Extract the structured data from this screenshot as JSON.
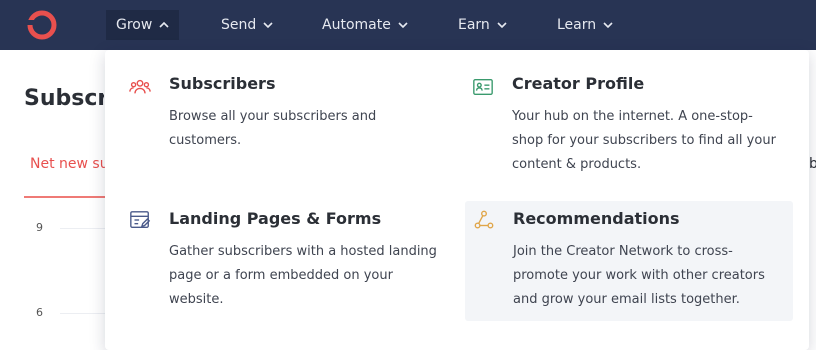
{
  "nav": {
    "items": [
      {
        "label": "Grow"
      },
      {
        "label": "Send"
      },
      {
        "label": "Automate"
      },
      {
        "label": "Earn"
      },
      {
        "label": "Learn"
      }
    ]
  },
  "background": {
    "page_title": "Subscribers",
    "active_tab": "Net new subscribers",
    "right_peek": "b",
    "axis_ticks": [
      "9",
      "6"
    ]
  },
  "dropdown": {
    "items": [
      {
        "title": "Subscribers",
        "description": "Browse all your subscribers and customers.",
        "icon": "users-icon"
      },
      {
        "title": "Creator Profile",
        "description": "Your hub on the internet. A one-stop-shop for your subscribers to find all your content & products.",
        "icon": "profile-card-icon"
      },
      {
        "title": "Landing Pages & Forms",
        "description": "Gather subscribers with a hosted landing page or a form embedded on your website.",
        "icon": "form-edit-icon"
      },
      {
        "title": "Recommendations",
        "description": "Join the Creator Network to cross-promote your work with other creators and grow your email lists together.",
        "icon": "network-icon"
      }
    ]
  },
  "colors": {
    "nav_bg": "#283454",
    "brand": "#e8504e",
    "profile_icon": "#3a9a6d",
    "form_icon": "#4a5a8a",
    "recommend_icon": "#e0a64a"
  }
}
